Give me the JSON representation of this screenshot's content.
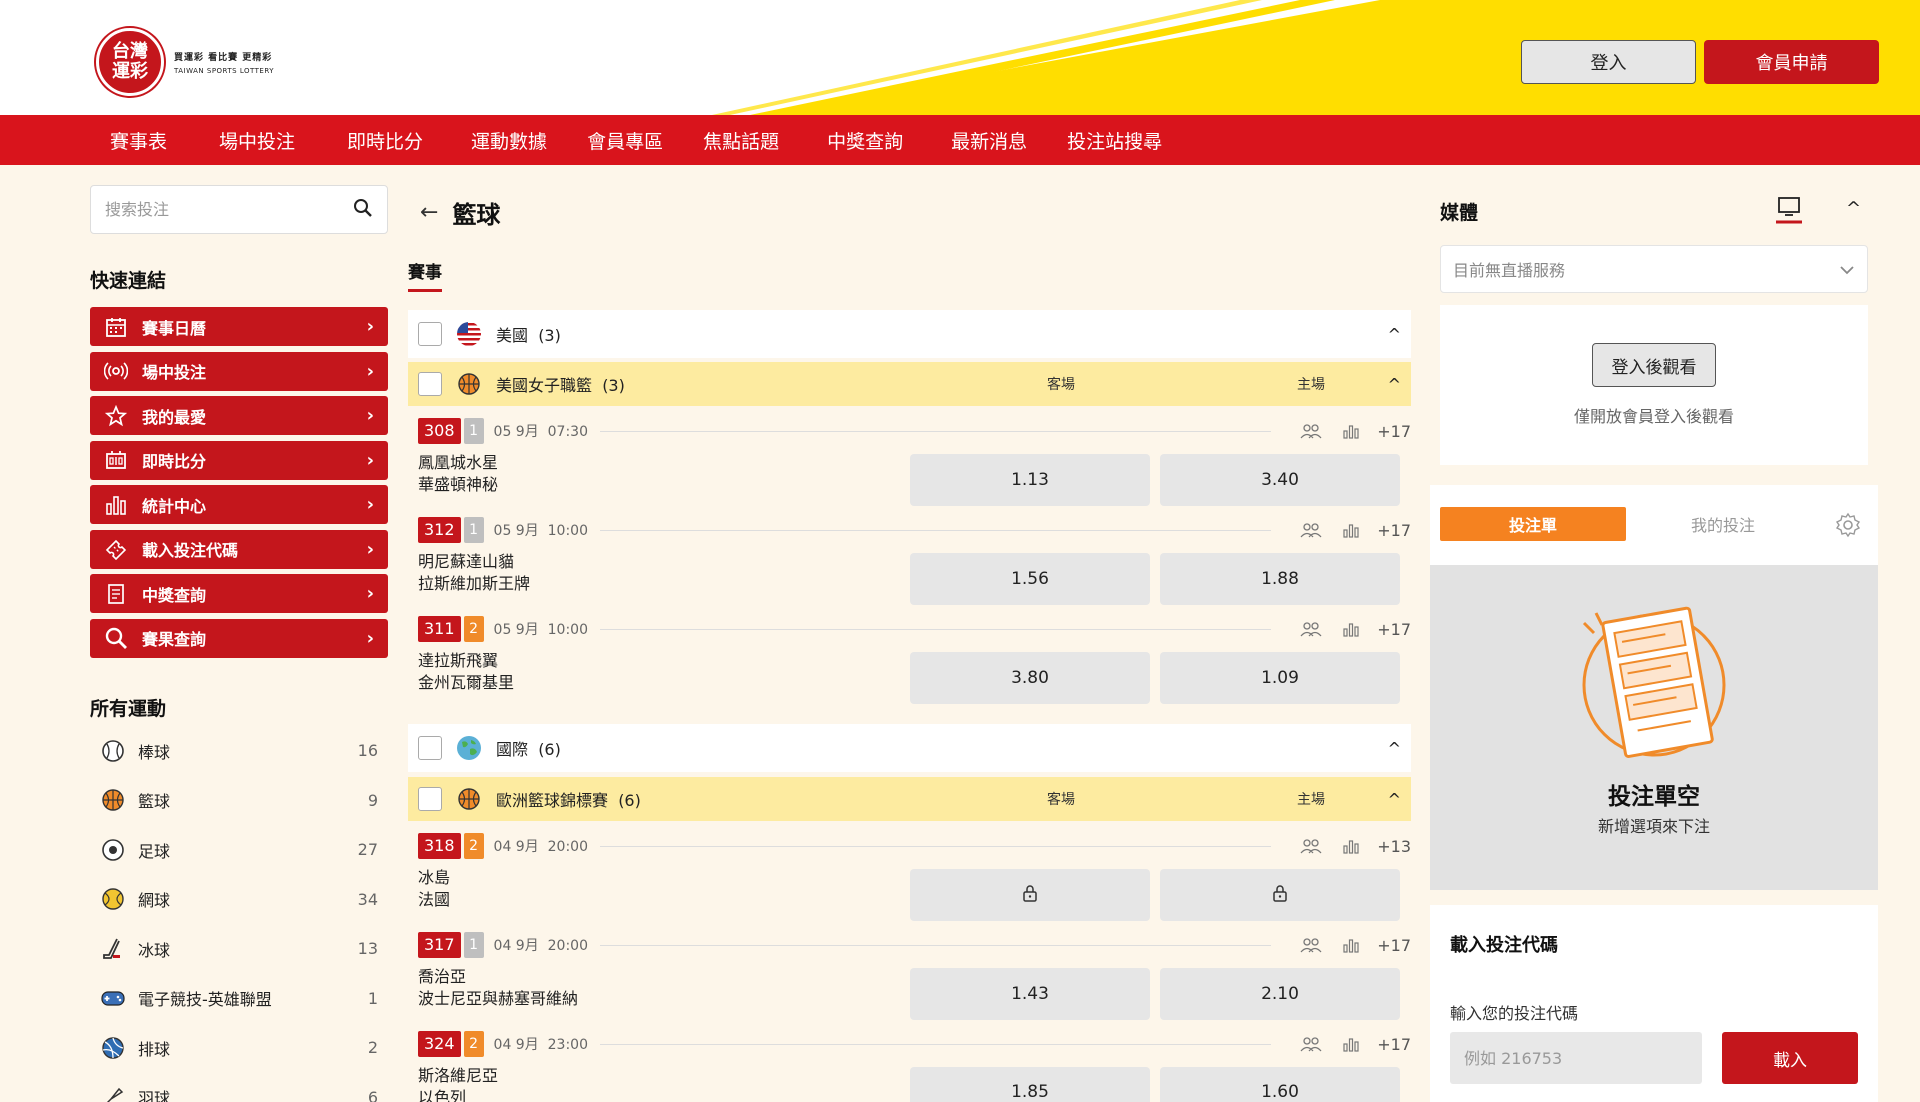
{
  "header": {
    "logo_main": [
      "台灣",
      "運彩"
    ],
    "logo_tagline": "買運彩  看比賽  更精彩",
    "logo_en": "TAIWAN SPORTS LOTTERY",
    "login_label": "登入",
    "register_label": "會員申請",
    "brand_color": "#c4161c",
    "accent_yellow": "#ffde00"
  },
  "nav": {
    "items": [
      "賽事表",
      "場中投注",
      "即時比分",
      "運動數據",
      "會員專區",
      "焦點話題",
      "中獎查詢",
      "最新消息",
      "投注站搜尋"
    ]
  },
  "left": {
    "search_placeholder": "搜索投注",
    "quick_links_title": "快速連結",
    "quick_links": [
      {
        "label": "賽事日曆",
        "icon": "calendar-icon"
      },
      {
        "label": "場中投注",
        "icon": "live-broadcast-icon"
      },
      {
        "label": "我的最愛",
        "icon": "star-icon"
      },
      {
        "label": "即時比分",
        "icon": "scoreboard-icon"
      },
      {
        "label": "統計中心",
        "icon": "bar-chart-icon"
      },
      {
        "label": "載入投注代碼",
        "icon": "ticket-icon"
      },
      {
        "label": "中獎查詢",
        "icon": "receipt-icon"
      },
      {
        "label": "賽果查詢",
        "icon": "search-icon"
      }
    ],
    "all_sports_title": "所有運動",
    "sports": [
      {
        "name": "棒球",
        "count": "16",
        "icon": "baseball-icon"
      },
      {
        "name": "籃球",
        "count": "9",
        "icon": "basketball-icon"
      },
      {
        "name": "足球",
        "count": "27",
        "icon": "soccer-icon"
      },
      {
        "name": "網球",
        "count": "34",
        "icon": "tennis-icon"
      },
      {
        "name": "冰球",
        "count": "13",
        "icon": "hockey-icon"
      },
      {
        "name": "電子競技-英雄聯盟",
        "count": "1",
        "icon": "gamepad-icon"
      },
      {
        "name": "排球",
        "count": "2",
        "icon": "volleyball-icon"
      },
      {
        "name": "羽球",
        "count": "6",
        "icon": "badminton-icon"
      }
    ]
  },
  "center": {
    "title": "籃球",
    "tab": "賽事",
    "groups": [
      {
        "country": "美國",
        "country_count": "(3)",
        "league": "美國女子職籃",
        "league_count": "(3)",
        "away_label": "客場",
        "home_label": "主場",
        "matches": [
          {
            "num": "308",
            "period": "1",
            "date": "05 9月",
            "time": "07:30",
            "teams": [
              "鳳凰城水星",
              "華盛頓神秘"
            ],
            "away": "1.13",
            "home": "3.40",
            "more": "+17"
          },
          {
            "num": "312",
            "period": "1",
            "date": "05 9月",
            "time": "10:00",
            "teams": [
              "明尼蘇達山貓",
              "拉斯維加斯王牌"
            ],
            "away": "1.56",
            "home": "1.88",
            "more": "+17"
          },
          {
            "num": "311",
            "period": "2",
            "date": "05 9月",
            "time": "10:00",
            "teams": [
              "達拉斯飛翼",
              "金州瓦爾基里"
            ],
            "away": "3.80",
            "home": "1.09",
            "more": "+17"
          }
        ]
      },
      {
        "country": "國際",
        "country_count": "(6)",
        "league": "歐洲籃球錦標賽",
        "league_count": "(6)",
        "away_label": "客場",
        "home_label": "主場",
        "matches": [
          {
            "num": "318",
            "period": "2",
            "date": "04 9月",
            "time": "20:00",
            "teams": [
              "冰島",
              "法國"
            ],
            "away": "",
            "home": "",
            "more": "+13",
            "locked": true
          },
          {
            "num": "317",
            "period": "1",
            "date": "04 9月",
            "time": "20:00",
            "teams": [
              "喬治亞",
              "波士尼亞與赫塞哥維納"
            ],
            "away": "1.43",
            "home": "2.10",
            "more": "+17"
          },
          {
            "num": "324",
            "period": "2",
            "date": "04 9月",
            "time": "23:00",
            "teams": [
              "斯洛維尼亞",
              "以色列"
            ],
            "away": "1.85",
            "home": "1.60",
            "more": "+17"
          }
        ]
      }
    ]
  },
  "right": {
    "media_title": "媒體",
    "media_select": "目前無直播服務",
    "watch_button": "登入後觀看",
    "watch_note": "僅開放會員登入後觀看",
    "slip_tab_active": "投注單",
    "slip_tab_other": "我的投注",
    "slip_empty_title": "投注單空",
    "slip_empty_sub": "新增選項來下注",
    "code_title": "載入投注代碼",
    "code_label": "輸入您的投注代碼",
    "code_placeholder": "例如 216753",
    "code_button": "載入"
  }
}
